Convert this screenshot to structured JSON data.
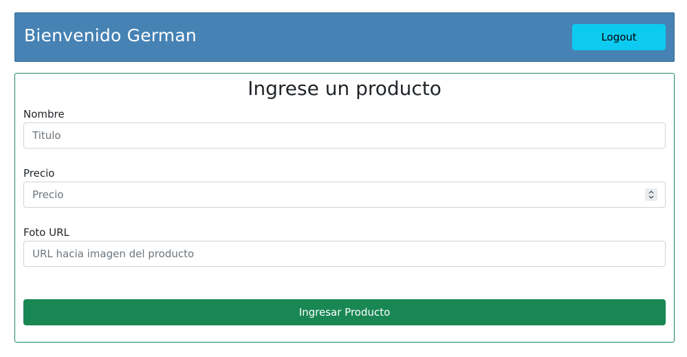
{
  "header": {
    "title": "Bienvenido German",
    "logout_label": "Logout"
  },
  "form": {
    "title": "Ingrese un producto",
    "fields": [
      {
        "label": "Nombre",
        "placeholder": "Titulo",
        "value": ""
      },
      {
        "label": "Precio",
        "placeholder": "Precio",
        "value": ""
      },
      {
        "label": "Foto URL",
        "placeholder": "URL hacia imagen del producto",
        "value": ""
      }
    ],
    "submit_label": "Ingresar Producto"
  },
  "colors": {
    "header_bg": "#4682b4",
    "logout_bg": "#0dcaf0",
    "submit_bg": "#198754",
    "card_border": "#198754"
  },
  "icons": {
    "number_spinner": "spinner-arrows-icon"
  }
}
